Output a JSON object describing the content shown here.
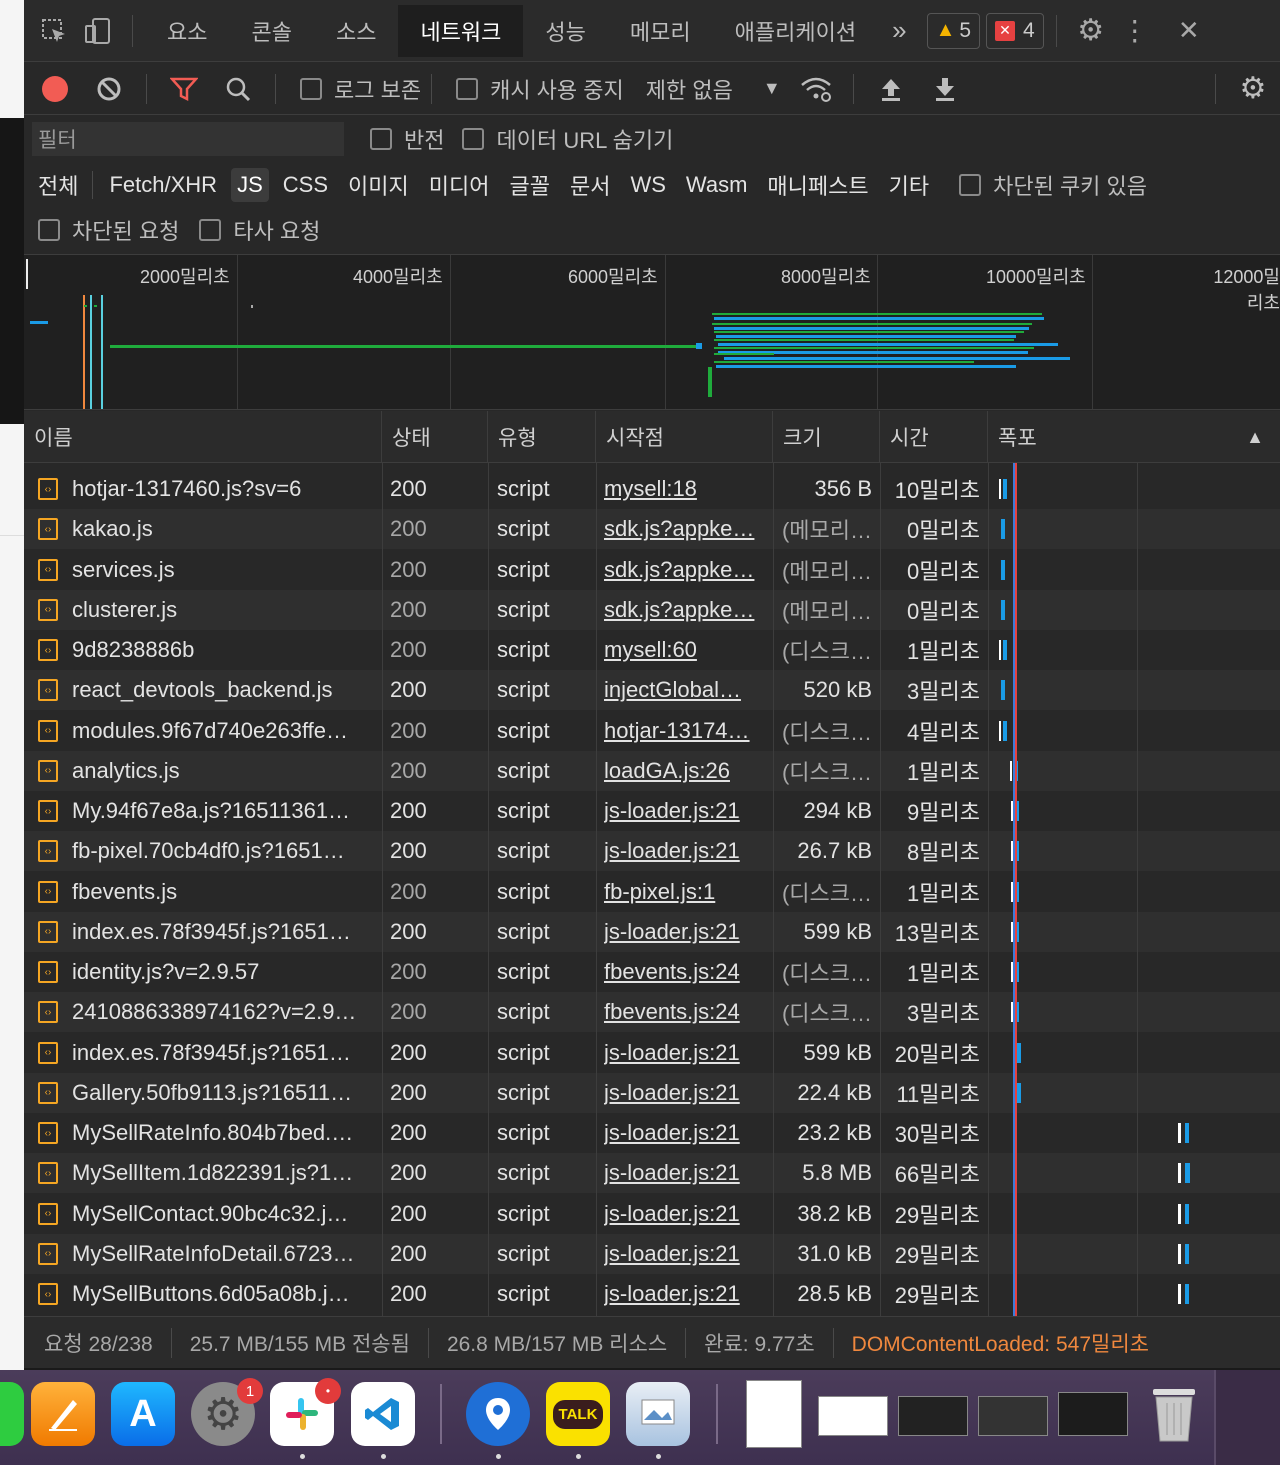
{
  "tabs": {
    "items": [
      "요소",
      "콘솔",
      "소스",
      "네트워크",
      "성능",
      "메모리",
      "애플리케이션"
    ],
    "more": "»",
    "warnings": "5",
    "errors": "4"
  },
  "toolbar": {
    "preserve_log": "로그 보존",
    "disable_cache": "캐시 사용 중지",
    "throttle": "제한 없음"
  },
  "filter": {
    "placeholder": "필터",
    "invert": "반전",
    "hide_data_urls": "데이터 URL 숨기기",
    "types": [
      "전체",
      "Fetch/XHR",
      "JS",
      "CSS",
      "이미지",
      "미디어",
      "글꼴",
      "문서",
      "WS",
      "Wasm",
      "매니페스트",
      "기타"
    ],
    "active_type": "JS",
    "blocked_cookies": "차단된 쿠키 있음",
    "blocked_requests": "차단된 요청",
    "third_party": "타사 요청"
  },
  "overview": {
    "ticks": [
      "2000밀리초",
      "4000밀리초",
      "6000밀리초",
      "8000밀리초",
      "10000밀리초",
      "12000밀리초"
    ]
  },
  "table": {
    "headers": [
      "이름",
      "상태",
      "유형",
      "시작점",
      "크기",
      "시간",
      "폭포"
    ],
    "rows": [
      {
        "name": "hotjar-1317460.js?sv=6",
        "status": "200",
        "type": "script",
        "initiator": "mysell:18",
        "size": "356 B",
        "time": "10밀리초",
        "dim": false
      },
      {
        "name": "kakao.js",
        "status": "200",
        "type": "script",
        "initiator": "sdk.js?appke…",
        "size": "(메모리…",
        "time": "0밀리초",
        "dim": true
      },
      {
        "name": "services.js",
        "status": "200",
        "type": "script",
        "initiator": "sdk.js?appke…",
        "size": "(메모리…",
        "time": "0밀리초",
        "dim": true
      },
      {
        "name": "clusterer.js",
        "status": "200",
        "type": "script",
        "initiator": "sdk.js?appke…",
        "size": "(메모리…",
        "time": "0밀리초",
        "dim": true
      },
      {
        "name": "9d8238886b",
        "status": "200",
        "type": "script",
        "initiator": "mysell:60",
        "size": "(디스크…",
        "time": "1밀리초",
        "dim": true
      },
      {
        "name": "react_devtools_backend.js",
        "status": "200",
        "type": "script",
        "initiator": "injectGlobal…",
        "size": "520 kB",
        "time": "3밀리초",
        "dim": false
      },
      {
        "name": "modules.9f67d740e263ffe…",
        "status": "200",
        "type": "script",
        "initiator": "hotjar-13174…",
        "size": "(디스크…",
        "time": "4밀리초",
        "dim": true
      },
      {
        "name": "analytics.js",
        "status": "200",
        "type": "script",
        "initiator": "loadGA.js:26",
        "size": "(디스크…",
        "time": "1밀리초",
        "dim": true
      },
      {
        "name": "My.94f67e8a.js?16511361…",
        "status": "200",
        "type": "script",
        "initiator": "js-loader.js:21",
        "size": "294 kB",
        "time": "9밀리초",
        "dim": false
      },
      {
        "name": "fb-pixel.70cb4df0.js?1651…",
        "status": "200",
        "type": "script",
        "initiator": "js-loader.js:21",
        "size": "26.7 kB",
        "time": "8밀리초",
        "dim": false
      },
      {
        "name": "fbevents.js",
        "status": "200",
        "type": "script",
        "initiator": "fb-pixel.js:1",
        "size": "(디스크…",
        "time": "1밀리초",
        "dim": true
      },
      {
        "name": "index.es.78f3945f.js?1651…",
        "status": "200",
        "type": "script",
        "initiator": "js-loader.js:21",
        "size": "599 kB",
        "time": "13밀리초",
        "dim": false
      },
      {
        "name": "identity.js?v=2.9.57",
        "status": "200",
        "type": "script",
        "initiator": "fbevents.js:24",
        "size": "(디스크…",
        "time": "1밀리초",
        "dim": true
      },
      {
        "name": "2410886338974162?v=2.9…",
        "status": "200",
        "type": "script",
        "initiator": "fbevents.js:24",
        "size": "(디스크…",
        "time": "3밀리초",
        "dim": true
      },
      {
        "name": "index.es.78f3945f.js?1651…",
        "status": "200",
        "type": "script",
        "initiator": "js-loader.js:21",
        "size": "599 kB",
        "time": "20밀리초",
        "dim": false
      },
      {
        "name": "Gallery.50fb9113.js?16511…",
        "status": "200",
        "type": "script",
        "initiator": "js-loader.js:21",
        "size": "22.4 kB",
        "time": "11밀리초",
        "dim": false
      },
      {
        "name": "MySellRateInfo.804b7bed.…",
        "status": "200",
        "type": "script",
        "initiator": "js-loader.js:21",
        "size": "23.2 kB",
        "time": "30밀리초",
        "dim": false
      },
      {
        "name": "MySellItem.1d822391.js?1…",
        "status": "200",
        "type": "script",
        "initiator": "js-loader.js:21",
        "size": "5.8 MB",
        "time": "66밀리초",
        "dim": false
      },
      {
        "name": "MySellContact.90bc4c32.j…",
        "status": "200",
        "type": "script",
        "initiator": "js-loader.js:21",
        "size": "38.2 kB",
        "time": "29밀리초",
        "dim": false
      },
      {
        "name": "MySellRateInfoDetail.6723…",
        "status": "200",
        "type": "script",
        "initiator": "js-loader.js:21",
        "size": "31.0 kB",
        "time": "29밀리초",
        "dim": false
      },
      {
        "name": "MySellButtons.6d05a08b.j…",
        "status": "200",
        "type": "script",
        "initiator": "js-loader.js:21",
        "size": "28.5 kB",
        "time": "29밀리초",
        "dim": false
      }
    ]
  },
  "status": {
    "requests": "요청 28/238",
    "transferred": "25.7 MB/155 MB 전송됨",
    "resources": "26.8 MB/157 MB 리소스",
    "finish": "완료: 9.77초",
    "dcl": "DOMContentLoaded: 547밀리초"
  },
  "dock": {
    "settings_badge": "1",
    "kakao_label": "TALK"
  },
  "colors": {
    "accent_blue": "#1a9be6",
    "accent_green": "#1fab3c",
    "error_red": "#e64141",
    "warn_yellow": "#f5b400",
    "dcl_orange": "#f0883e"
  }
}
